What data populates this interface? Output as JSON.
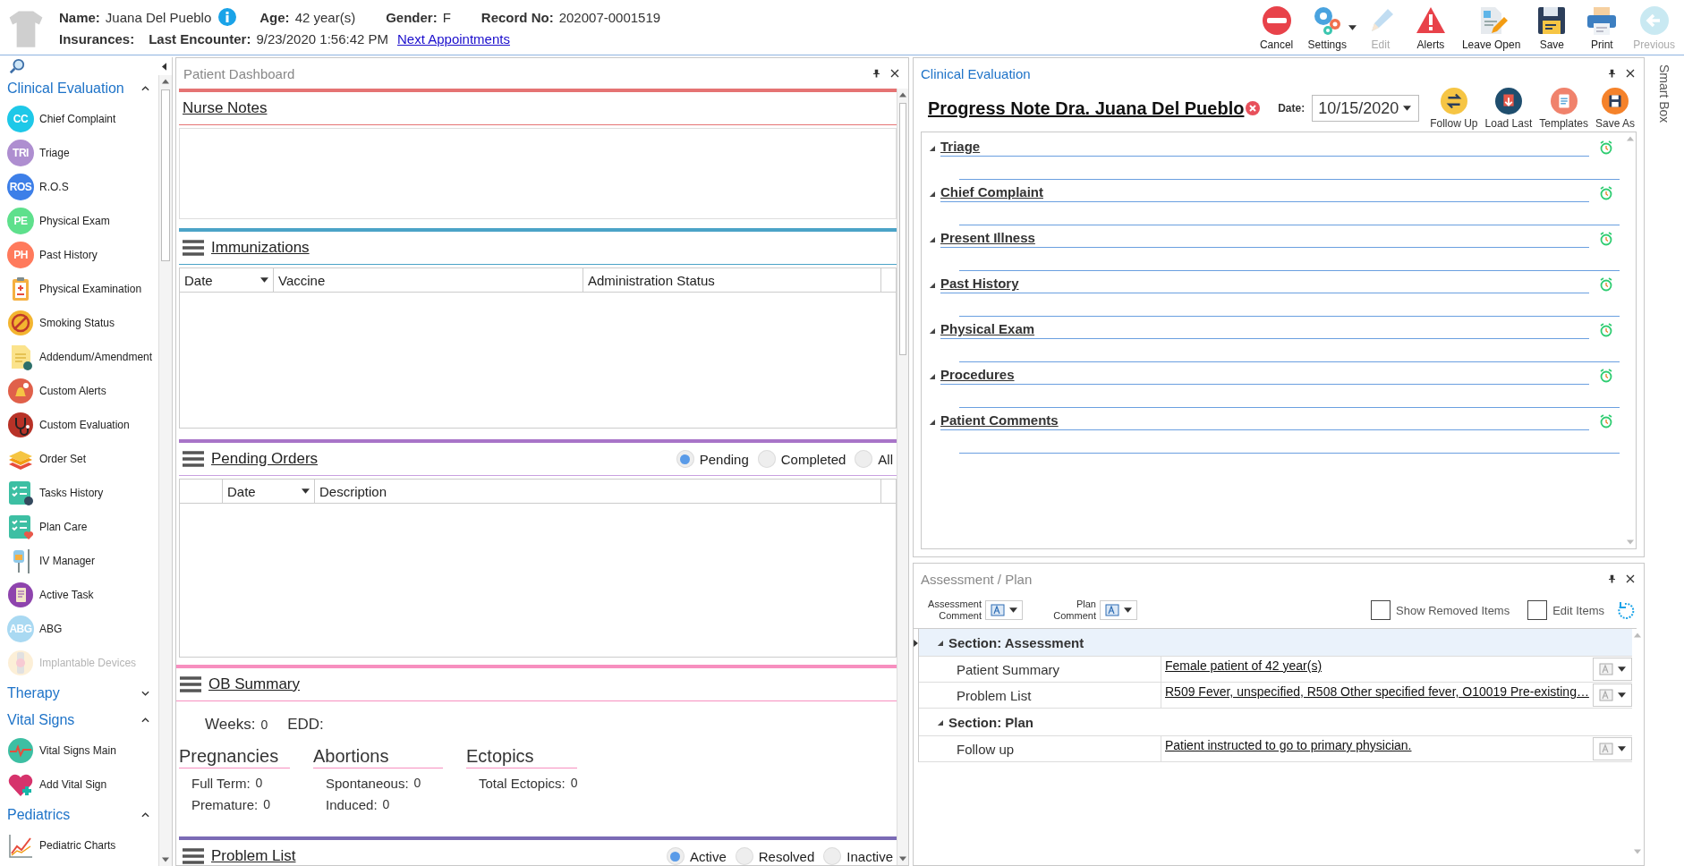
{
  "header": {
    "fields": [
      {
        "label": "Name:",
        "value": "Juana Del Pueblo",
        "info": true
      },
      {
        "label": "Age:",
        "value": "42 year(s)",
        "info": false
      },
      {
        "label": "Gender:",
        "value": "F",
        "info": false
      },
      {
        "label": "Record No:",
        "value": "202007-0001519",
        "info": false
      }
    ],
    "insurances_label": "Insurances:",
    "last_encounter_label": "Last Encounter:",
    "last_encounter": "9/23/2020 1:56:42 PM",
    "next_appointments_link": "Next Appointments"
  },
  "toolbar": [
    {
      "label": "Cancel",
      "disabled": false,
      "dropdown": false
    },
    {
      "label": "Settings",
      "disabled": false,
      "dropdown": true
    },
    {
      "label": "Edit",
      "disabled": true,
      "dropdown": false
    },
    {
      "label": "Alerts",
      "disabled": false,
      "dropdown": false
    },
    {
      "label": "Leave Open",
      "disabled": false,
      "dropdown": false
    },
    {
      "label": "Save",
      "disabled": false,
      "dropdown": false
    },
    {
      "label": "Print",
      "disabled": false,
      "dropdown": false
    },
    {
      "label": "Previous",
      "disabled": true,
      "dropdown": false
    }
  ],
  "sidebar": {
    "groups": [
      {
        "title": "Clinical Evaluation",
        "expanded": true,
        "items": [
          {
            "label": "Chief Complaint",
            "icon_text": "CC",
            "disabled": false
          },
          {
            "label": "Triage",
            "icon_text": "TRI",
            "disabled": false
          },
          {
            "label": "R.O.S",
            "icon_text": "ROS",
            "disabled": false
          },
          {
            "label": "Physical Exam",
            "icon_text": "PE",
            "disabled": false
          },
          {
            "label": "Past History",
            "icon_text": "PH",
            "disabled": false
          },
          {
            "label": "Physical Examination",
            "disabled": false
          },
          {
            "label": "Smoking Status",
            "disabled": false
          },
          {
            "label": "Addendum/Amendment",
            "disabled": false
          },
          {
            "label": "Custom Alerts",
            "disabled": false
          },
          {
            "label": "Custom Evaluation",
            "disabled": false
          },
          {
            "label": "Order Set",
            "disabled": false
          },
          {
            "label": "Tasks History",
            "disabled": false
          },
          {
            "label": "Plan Care",
            "disabled": false
          },
          {
            "label": "IV Manager",
            "disabled": false
          },
          {
            "label": "Active Task",
            "disabled": false
          },
          {
            "label": "ABG",
            "icon_text": "ABG",
            "disabled": false
          },
          {
            "label": "Implantable Devices",
            "disabled": true
          }
        ]
      },
      {
        "title": "Therapy",
        "expanded": false
      },
      {
        "title": "Vital Signs",
        "expanded": true,
        "items": [
          {
            "label": "Vital Signs Main",
            "disabled": false
          },
          {
            "label": "Add Vital Sign",
            "disabled": false
          }
        ]
      },
      {
        "title": "Pediatrics",
        "expanded": true,
        "items": [
          {
            "label": "Pediatric Charts",
            "disabled": false
          }
        ]
      }
    ]
  },
  "dashboard": {
    "title": "Patient Dashboard",
    "nurse_notes": {
      "title": "Nurse Notes"
    },
    "immunizations": {
      "title": "Immunizations",
      "columns": [
        {
          "label": "Date",
          "filter": true
        },
        {
          "label": "Vaccine",
          "filter": false
        },
        {
          "label": "Administration Status",
          "filter": false
        }
      ]
    },
    "pending_orders": {
      "title": "Pending Orders",
      "filters": [
        {
          "label": "Pending",
          "selected": true
        },
        {
          "label": "Completed",
          "selected": false
        },
        {
          "label": "All",
          "selected": false
        }
      ],
      "columns": [
        {
          "label": "Date",
          "filter": true
        },
        {
          "label": "Description",
          "filter": false
        }
      ]
    },
    "ob_summary": {
      "title": "OB Summary",
      "weeks_label": "Weeks:",
      "weeks": "0",
      "edd_label": "EDD:",
      "groups": [
        {
          "title": "Pregnancies",
          "lines": [
            {
              "label": "Full Term:",
              "value": "0"
            },
            {
              "label": "Premature:",
              "value": "0"
            }
          ]
        },
        {
          "title": "Abortions",
          "lines": [
            {
              "label": "Spontaneous:",
              "value": "0"
            },
            {
              "label": "Induced:",
              "value": "0"
            }
          ]
        },
        {
          "title": "Ectopics",
          "lines": [
            {
              "label": "Total Ectopics:",
              "value": "0"
            }
          ]
        }
      ]
    },
    "problem_list": {
      "title": "Problem List",
      "filters": [
        {
          "label": "Active",
          "selected": true
        },
        {
          "label": "Resolved",
          "selected": false
        },
        {
          "label": "Inactive",
          "selected": false
        }
      ]
    }
  },
  "clinical_evaluation": {
    "title": "Clinical Evaluation",
    "note_title": "Progress Note Dra. Juana Del Pueblo",
    "date_label": "Date:",
    "date": "10/15/2020",
    "actions": [
      "Follow Up",
      "Load Last",
      "Templates",
      "Save As"
    ],
    "sections": [
      {
        "title": "Triage",
        "expanded": true
      },
      {
        "title": "Chief Complaint",
        "expanded": true
      },
      {
        "title": "Present Illness",
        "expanded": true
      },
      {
        "title": "Past History",
        "expanded": true
      },
      {
        "title": "Physical Exam",
        "expanded": true
      },
      {
        "title": "Procedures",
        "expanded": true
      },
      {
        "title": "Patient Comments",
        "expanded": true
      }
    ]
  },
  "assessment_plan": {
    "title": "Assessment / Plan",
    "comment_pickers": [
      "Assessment Comment",
      "Plan Comment"
    ],
    "options": [
      {
        "label": "Show Removed Items",
        "checked": false
      },
      {
        "label": "Edit Items",
        "checked": false
      }
    ],
    "sections": [
      {
        "title": "Section: Assessment",
        "expanded": true,
        "rows": [
          {
            "label": "Patient Summary",
            "value": "Female patient of 42 year(s)"
          },
          {
            "label": "Problem List",
            "value": "R509 Fever, unspecified, R508 Other specified fever, O10019 Pre-existing…"
          }
        ]
      },
      {
        "title": "Section: Plan",
        "expanded": true,
        "rows": [
          {
            "label": "Follow up",
            "value": "Patient instructed to go to primary physician."
          }
        ]
      }
    ]
  },
  "smart_box": {
    "label": "Smart Box"
  }
}
